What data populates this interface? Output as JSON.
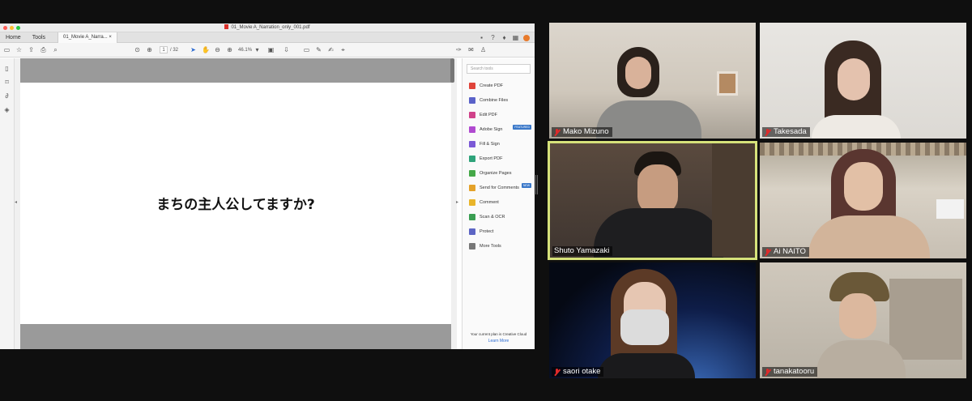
{
  "acrobat": {
    "window_title": "01_Movie A_Narration_only_001.pdf",
    "tabs": {
      "home": "Home",
      "tools": "Tools",
      "doc": "01_Movie A_Narra...",
      "close": "×"
    },
    "page_current": "1",
    "page_total": "/ 32",
    "zoom": "46.1%",
    "page_text": "まちの主人公してますか?",
    "search_placeholder": "Search tools",
    "tools": [
      {
        "label": "Create PDF",
        "color": "#e0443a",
        "badge": ""
      },
      {
        "label": "Combine Files",
        "color": "#5a62c9",
        "badge": ""
      },
      {
        "label": "Edit PDF",
        "color": "#d0428a",
        "badge": ""
      },
      {
        "label": "Adobe Sign",
        "color": "#b04ad0",
        "badge": "FEATURED"
      },
      {
        "label": "Fill & Sign",
        "color": "#7b59d6",
        "badge": ""
      },
      {
        "label": "Export PDF",
        "color": "#2ea37a",
        "badge": ""
      },
      {
        "label": "Organize Pages",
        "color": "#45a848",
        "badge": ""
      },
      {
        "label": "Send for Comments",
        "color": "#e4a22a",
        "badge": "NEW"
      },
      {
        "label": "Comment",
        "color": "#e9b52a",
        "badge": ""
      },
      {
        "label": "Scan & OCR",
        "color": "#3a9e52",
        "badge": ""
      },
      {
        "label": "Protect",
        "color": "#5c65c4",
        "badge": ""
      },
      {
        "label": "More Tools",
        "color": "#777777",
        "badge": ""
      }
    ],
    "plan_text": "Your current plan is Creative Cloud",
    "learn_more": "Learn More"
  },
  "participants": [
    {
      "name": "Mako Mizuno"
    },
    {
      "name": "Takesada"
    },
    {
      "name": "Shuto Yamazaki"
    },
    {
      "name": "Ai NAITO"
    },
    {
      "name": "saori otake"
    },
    {
      "name": "tanakatooru"
    }
  ]
}
